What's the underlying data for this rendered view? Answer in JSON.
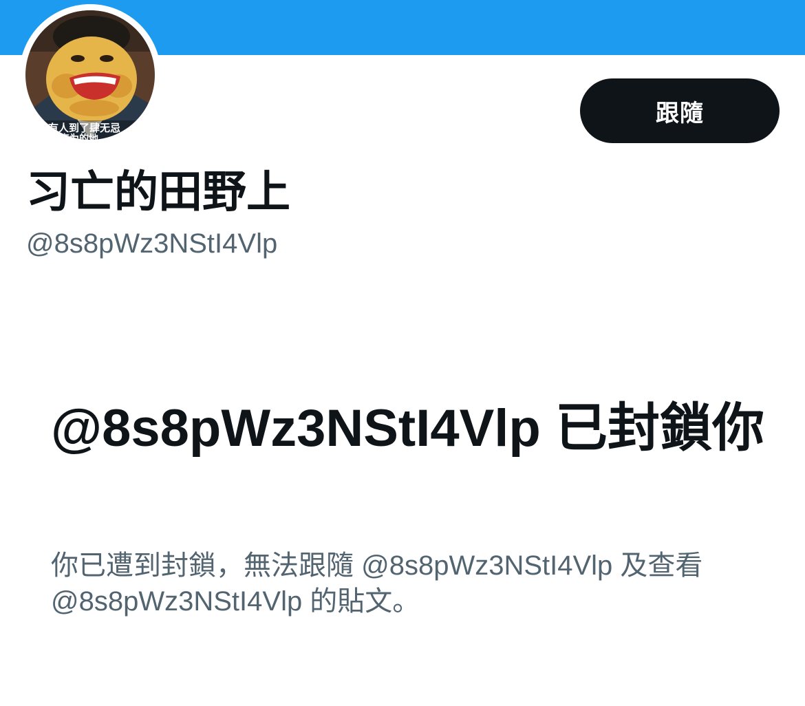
{
  "header": {
    "banner_color": "#1d9bf0"
  },
  "profile": {
    "avatar_icon": "cartoon-avatar",
    "avatar_caption": "经有人到了肆无忌",
    "avatar_caption_2": "忘为的地",
    "follow_label": "跟隨",
    "display_name": "习亡的田野上",
    "handle": "@8s8pWz3NStI4Vlp"
  },
  "blocked_notice": {
    "title": "@8s8pWz3NStI4Vlp 已封鎖你",
    "description": "你已遭到封鎖，無法跟隨 @8s8pWz3NStI4Vlp 及查看 @8s8pWz3NStI4Vlp 的貼文。"
  },
  "colors": {
    "primary_text": "#0f1419",
    "secondary_text": "#536471",
    "button_bg": "#0f1419",
    "button_text": "#ffffff"
  }
}
